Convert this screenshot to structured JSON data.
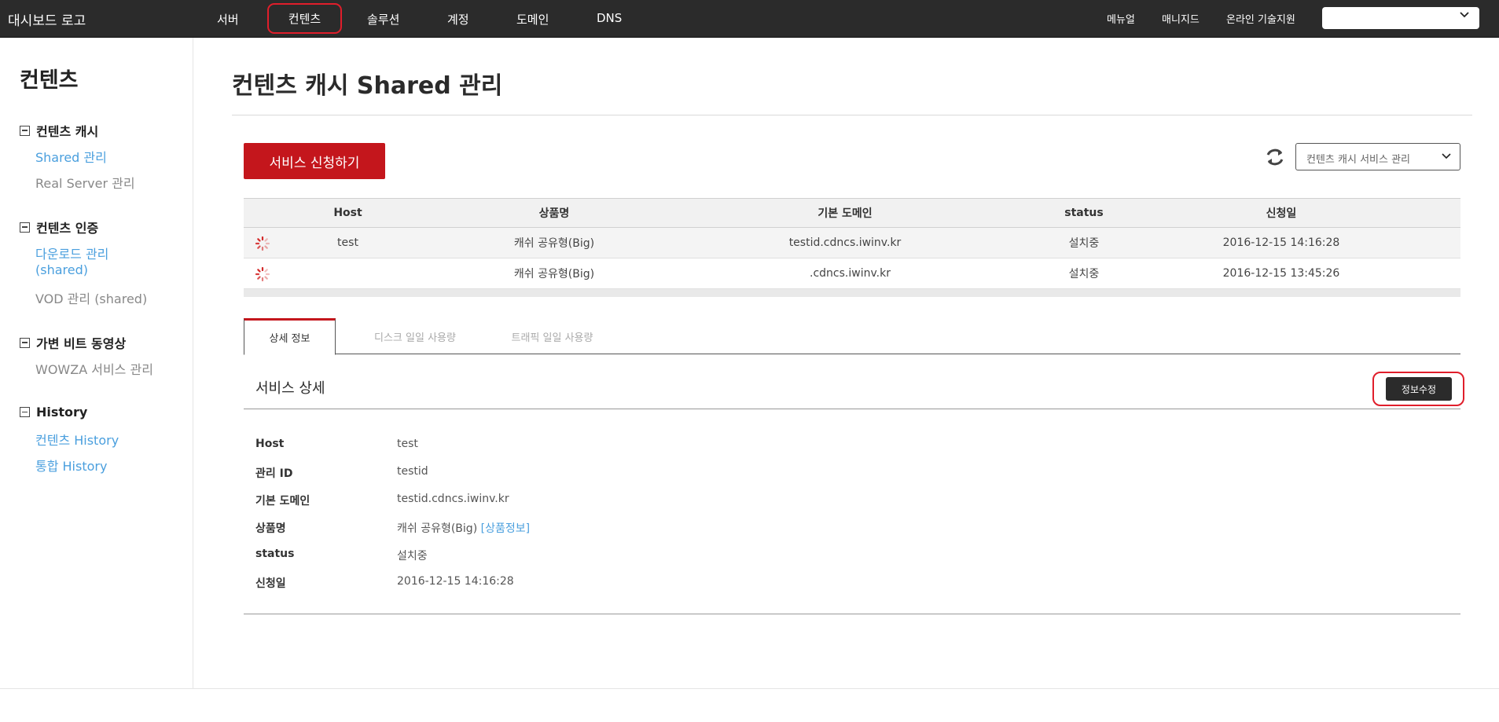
{
  "header": {
    "logo": "대시보드 로고",
    "nav": [
      {
        "label": "서버"
      },
      {
        "label": "컨텐츠"
      },
      {
        "label": "솔루션"
      },
      {
        "label": "계정"
      },
      {
        "label": "도메인"
      },
      {
        "label": "DNS"
      }
    ],
    "right": [
      {
        "label": "메뉴얼"
      },
      {
        "label": "매니지드"
      },
      {
        "label": "온라인 기술지원"
      }
    ],
    "select_value": ""
  },
  "sidebar": {
    "title": "컨텐츠",
    "groups": [
      {
        "title": "컨텐츠 캐시",
        "items": [
          "Shared 관리",
          "Real Server 관리"
        ]
      },
      {
        "title": "컨텐츠 인증",
        "items": [
          "다운로드 관리",
          "(shared)",
          "VOD 관리 (shared)"
        ]
      },
      {
        "title": "가변 비트 동영상",
        "items": [
          "WOWZA 서비스 관리"
        ]
      },
      {
        "title": "History",
        "items": [
          "컨텐츠 History",
          "통합 History"
        ]
      }
    ]
  },
  "main": {
    "title": "컨텐츠 캐시 Shared 관리",
    "apply_button": "서비스 신청하기",
    "service_select": "컨텐츠 캐시 서비스 관리",
    "table": {
      "columns": [
        "Host",
        "상품명",
        "기본 도메인",
        "status",
        "신청일"
      ],
      "rows": [
        {
          "host": "test",
          "product": "캐쉬 공유형(Big)",
          "domain": "testid.cdncs.iwinv.kr",
          "status": "설치중",
          "date": "2016-12-15 14:16:28"
        },
        {
          "host": "",
          "product": "캐쉬 공유형(Big)",
          "domain": ".cdncs.iwinv.kr",
          "status": "설치중",
          "date": "2016-12-15 13:45:26"
        }
      ]
    },
    "tabs": [
      "상세 정보",
      "디스크 일일 사용량",
      "트래픽 일일 사용량"
    ],
    "detail": {
      "title": "서비스 상세",
      "edit_button": "정보수정",
      "fields": [
        {
          "key": "Host",
          "value": "test"
        },
        {
          "key": "관리 ID",
          "value": "testid"
        },
        {
          "key": "기본 도메인",
          "value": "testid.cdncs.iwinv.kr"
        },
        {
          "key": "상품명",
          "value": "캐쉬 공유형(Big)",
          "link": "[상품정보]"
        },
        {
          "key": "status",
          "value": "설치중"
        },
        {
          "key": "신청일",
          "value": "2016-12-15 14:16:28"
        }
      ]
    }
  },
  "colors": {
    "accent_red": "#c4161c",
    "highlight_red": "#e01e2b",
    "link_blue": "#4a9fde",
    "topbar": "#2b2b2b"
  }
}
